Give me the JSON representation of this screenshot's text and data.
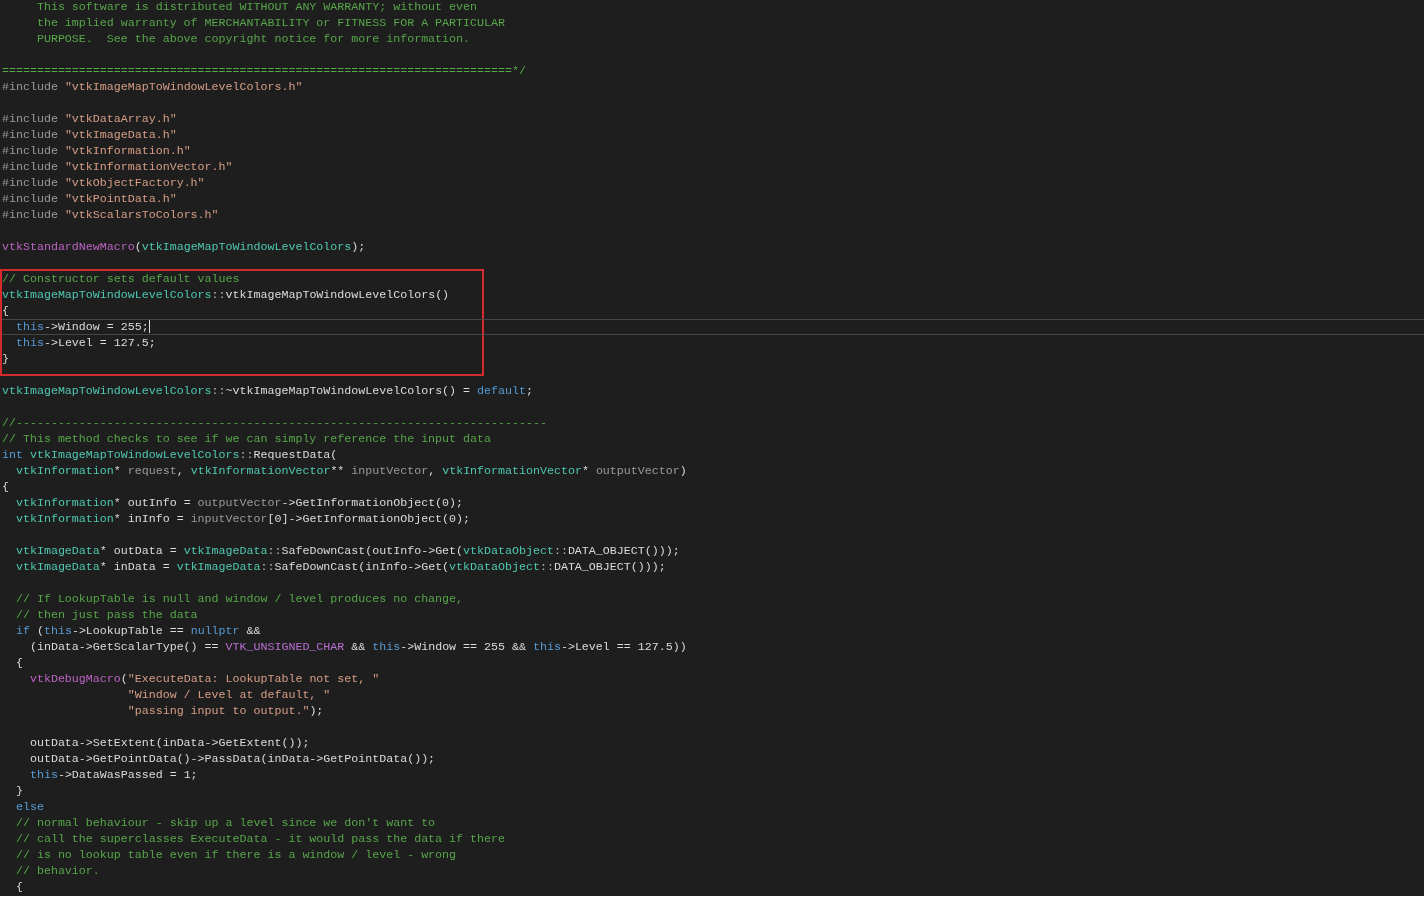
{
  "editor": {
    "blocks": [
      {
        "kind": "plain",
        "lines": [
          {
            "kind": "code",
            "tokens": [
              {
                "kind": "comment",
                "text": "     This software is distributed WITHOUT ANY WARRANTY; without even"
              }
            ]
          },
          {
            "kind": "code",
            "tokens": [
              {
                "kind": "comment",
                "text": "     the implied warranty of MERCHANTABILITY or FITNESS FOR A PARTICULAR"
              }
            ]
          },
          {
            "kind": "code",
            "tokens": [
              {
                "kind": "comment",
                "text": "     PURPOSE.  See the above copyright notice for more information."
              }
            ]
          },
          {
            "kind": "blank"
          },
          {
            "kind": "code",
            "tokens": [
              {
                "kind": "comment",
                "text": "=========================================================================*/"
              }
            ]
          },
          {
            "kind": "code",
            "tokens": [
              {
                "kind": "preproc",
                "text": "#include "
              },
              {
                "kind": "string",
                "text": "\"vtkImageMapToWindowLevelColors.h\""
              }
            ]
          },
          {
            "kind": "blank"
          },
          {
            "kind": "code",
            "tokens": [
              {
                "kind": "preproc",
                "text": "#include "
              },
              {
                "kind": "string",
                "text": "\"vtkDataArray.h\""
              }
            ]
          },
          {
            "kind": "code",
            "tokens": [
              {
                "kind": "preproc",
                "text": "#include "
              },
              {
                "kind": "string",
                "text": "\"vtkImageData.h\""
              }
            ]
          },
          {
            "kind": "code",
            "tokens": [
              {
                "kind": "preproc",
                "text": "#include "
              },
              {
                "kind": "string",
                "text": "\"vtkInformation.h\""
              }
            ]
          },
          {
            "kind": "code",
            "tokens": [
              {
                "kind": "preproc",
                "text": "#include "
              },
              {
                "kind": "string",
                "text": "\"vtkInformationVector.h\""
              }
            ]
          },
          {
            "kind": "code",
            "tokens": [
              {
                "kind": "preproc",
                "text": "#include "
              },
              {
                "kind": "string",
                "text": "\"vtkObjectFactory.h\""
              }
            ]
          },
          {
            "kind": "code",
            "tokens": [
              {
                "kind": "preproc",
                "text": "#include "
              },
              {
                "kind": "string",
                "text": "\"vtkPointData.h\""
              }
            ]
          },
          {
            "kind": "code",
            "tokens": [
              {
                "kind": "preproc",
                "text": "#include "
              },
              {
                "kind": "string",
                "text": "\"vtkScalarsToColors.h\""
              }
            ]
          },
          {
            "kind": "blank"
          },
          {
            "kind": "code",
            "tokens": [
              {
                "kind": "macro",
                "text": "vtkStandardNewMacro"
              },
              {
                "kind": "plain",
                "text": "("
              },
              {
                "kind": "type",
                "text": "vtkImageMapToWindowLevelColors"
              },
              {
                "kind": "plain",
                "text": ");"
              }
            ]
          },
          {
            "kind": "blank"
          }
        ]
      },
      {
        "kind": "framed",
        "lines": [
          {
            "kind": "code",
            "tokens": [
              {
                "kind": "comment",
                "text": "// Constructor sets default values"
              }
            ]
          },
          {
            "kind": "code",
            "tokens": [
              {
                "kind": "type",
                "text": "vtkImageMapToWindowLevelColors"
              },
              {
                "kind": "punct",
                "text": "::"
              },
              {
                "kind": "plain",
                "text": "vtkImageMapToWindowLevelColors()"
              }
            ]
          },
          {
            "kind": "code",
            "tokens": [
              {
                "kind": "plain",
                "text": "{"
              }
            ]
          },
          {
            "kind": "current",
            "tokens": [
              {
                "kind": "keyword",
                "text": "  this"
              },
              {
                "kind": "plain",
                "text": "->Window = 255;"
              }
            ]
          },
          {
            "kind": "code",
            "tokens": [
              {
                "kind": "keyword",
                "text": "  this"
              },
              {
                "kind": "plain",
                "text": "->Level = 127.5;"
              }
            ]
          },
          {
            "kind": "code",
            "tokens": [
              {
                "kind": "plain",
                "text": "}"
              }
            ]
          }
        ]
      },
      {
        "kind": "plain",
        "lines": [
          {
            "kind": "code",
            "tokens": [
              {
                "kind": "type",
                "text": "vtkImageMapToWindowLevelColors"
              },
              {
                "kind": "punct",
                "text": "::"
              },
              {
                "kind": "plain",
                "text": "~vtkImageMapToWindowLevelColors() = "
              },
              {
                "kind": "keyword",
                "text": "default"
              },
              {
                "kind": "plain",
                "text": ";"
              }
            ]
          },
          {
            "kind": "blank"
          },
          {
            "kind": "code",
            "tokens": [
              {
                "kind": "comment",
                "text": "//----------------------------------------------------------------------------"
              }
            ]
          },
          {
            "kind": "code",
            "tokens": [
              {
                "kind": "comment",
                "text": "// This method checks to see if we can simply reference the input data"
              }
            ]
          },
          {
            "kind": "code",
            "tokens": [
              {
                "kind": "keyword",
                "text": "int "
              },
              {
                "kind": "type",
                "text": "vtkImageMapToWindowLevelColors"
              },
              {
                "kind": "punct",
                "text": "::"
              },
              {
                "kind": "plain",
                "text": "RequestData("
              }
            ]
          },
          {
            "kind": "code",
            "tokens": [
              {
                "kind": "type",
                "text": "  vtkInformation"
              },
              {
                "kind": "plain",
                "text": "* "
              },
              {
                "kind": "param",
                "text": "request"
              },
              {
                "kind": "plain",
                "text": ", "
              },
              {
                "kind": "type",
                "text": "vtkInformationVector"
              },
              {
                "kind": "plain",
                "text": "** "
              },
              {
                "kind": "param",
                "text": "inputVector"
              },
              {
                "kind": "plain",
                "text": ", "
              },
              {
                "kind": "type",
                "text": "vtkInformationVector"
              },
              {
                "kind": "plain",
                "text": "* "
              },
              {
                "kind": "param",
                "text": "outputVector"
              },
              {
                "kind": "plain",
                "text": ")"
              }
            ]
          },
          {
            "kind": "code",
            "tokens": [
              {
                "kind": "plain",
                "text": "{"
              }
            ]
          },
          {
            "kind": "code",
            "tokens": [
              {
                "kind": "type",
                "text": "  vtkInformation"
              },
              {
                "kind": "plain",
                "text": "* outInfo = "
              },
              {
                "kind": "param",
                "text": "outputVector"
              },
              {
                "kind": "plain",
                "text": "->GetInformationObject(0);"
              }
            ]
          },
          {
            "kind": "code",
            "tokens": [
              {
                "kind": "type",
                "text": "  vtkInformation"
              },
              {
                "kind": "plain",
                "text": "* inInfo = "
              },
              {
                "kind": "param",
                "text": "inputVector"
              },
              {
                "kind": "plain",
                "text": "[0]->GetInformationObject(0);"
              }
            ]
          },
          {
            "kind": "blank"
          },
          {
            "kind": "code",
            "tokens": [
              {
                "kind": "type",
                "text": "  vtkImageData"
              },
              {
                "kind": "plain",
                "text": "* outData = "
              },
              {
                "kind": "type",
                "text": "vtkImageData"
              },
              {
                "kind": "punct",
                "text": "::"
              },
              {
                "kind": "plain",
                "text": "SafeDownCast(outInfo->Get("
              },
              {
                "kind": "type",
                "text": "vtkDataObject"
              },
              {
                "kind": "punct",
                "text": "::"
              },
              {
                "kind": "plain",
                "text": "DATA_OBJECT()));"
              }
            ]
          },
          {
            "kind": "code",
            "tokens": [
              {
                "kind": "type",
                "text": "  vtkImageData"
              },
              {
                "kind": "plain",
                "text": "* inData = "
              },
              {
                "kind": "type",
                "text": "vtkImageData"
              },
              {
                "kind": "punct",
                "text": "::"
              },
              {
                "kind": "plain",
                "text": "SafeDownCast(inInfo->Get("
              },
              {
                "kind": "type",
                "text": "vtkDataObject"
              },
              {
                "kind": "punct",
                "text": "::"
              },
              {
                "kind": "plain",
                "text": "DATA_OBJECT()));"
              }
            ]
          },
          {
            "kind": "blank"
          },
          {
            "kind": "code",
            "tokens": [
              {
                "kind": "comment",
                "text": "  // If LookupTable is null and window / level produces no change,"
              }
            ]
          },
          {
            "kind": "code",
            "tokens": [
              {
                "kind": "comment",
                "text": "  // then just pass the data"
              }
            ]
          },
          {
            "kind": "code",
            "tokens": [
              {
                "kind": "keyword",
                "text": "  if"
              },
              {
                "kind": "plain",
                "text": " ("
              },
              {
                "kind": "keyword",
                "text": "this"
              },
              {
                "kind": "plain",
                "text": "->LookupTable == "
              },
              {
                "kind": "keyword",
                "text": "nullptr"
              },
              {
                "kind": "plain",
                "text": " &&"
              }
            ]
          },
          {
            "kind": "code",
            "tokens": [
              {
                "kind": "plain",
                "text": "    (inData->GetScalarType() == "
              },
              {
                "kind": "enum",
                "text": "VTK_UNSIGNED_CHAR"
              },
              {
                "kind": "plain",
                "text": " && "
              },
              {
                "kind": "keyword",
                "text": "this"
              },
              {
                "kind": "plain",
                "text": "->Window == 255 && "
              },
              {
                "kind": "keyword",
                "text": "this"
              },
              {
                "kind": "plain",
                "text": "->Level == 127.5))"
              }
            ]
          },
          {
            "kind": "code",
            "tokens": [
              {
                "kind": "plain",
                "text": "  {"
              }
            ]
          },
          {
            "kind": "code",
            "tokens": [
              {
                "kind": "macro",
                "text": "    vtkDebugMacro"
              },
              {
                "kind": "plain",
                "text": "("
              },
              {
                "kind": "string",
                "text": "\"ExecuteData: LookupTable not set, \""
              }
            ]
          },
          {
            "kind": "code",
            "tokens": [
              {
                "kind": "string",
                "text": "                  \"Window / Level at default, \""
              }
            ]
          },
          {
            "kind": "code",
            "tokens": [
              {
                "kind": "string",
                "text": "                  \"passing input to output.\""
              },
              {
                "kind": "plain",
                "text": ");"
              }
            ]
          },
          {
            "kind": "blank"
          },
          {
            "kind": "code",
            "tokens": [
              {
                "kind": "plain",
                "text": "    outData->SetExtent(inData->GetExtent());"
              }
            ]
          },
          {
            "kind": "code",
            "tokens": [
              {
                "kind": "plain",
                "text": "    outData->GetPointData()->PassData(inData->GetPointData());"
              }
            ]
          },
          {
            "kind": "code",
            "tokens": [
              {
                "kind": "keyword",
                "text": "    this"
              },
              {
                "kind": "plain",
                "text": "->DataWasPassed = 1;"
              }
            ]
          },
          {
            "kind": "code",
            "tokens": [
              {
                "kind": "plain",
                "text": "  }"
              }
            ]
          },
          {
            "kind": "code",
            "tokens": [
              {
                "kind": "keyword",
                "text": "  else"
              }
            ]
          },
          {
            "kind": "code",
            "tokens": [
              {
                "kind": "comment",
                "text": "  // normal behaviour - skip up a level since we don't want to"
              }
            ]
          },
          {
            "kind": "code",
            "tokens": [
              {
                "kind": "comment",
                "text": "  // call the superclasses ExecuteData - it would pass the data if there"
              }
            ]
          },
          {
            "kind": "code",
            "tokens": [
              {
                "kind": "comment",
                "text": "  // is no lookup table even if there is a window / level - wrong"
              }
            ]
          },
          {
            "kind": "code",
            "tokens": [
              {
                "kind": "comment",
                "text": "  // behavior."
              }
            ]
          },
          {
            "kind": "code",
            "tokens": [
              {
                "kind": "plain",
                "text": "  {"
              }
            ]
          }
        ]
      }
    ]
  }
}
